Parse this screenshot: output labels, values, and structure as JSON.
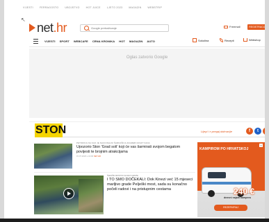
{
  "topbar": [
    "Vijesti",
    "Ferragosto",
    "Ubojstvo",
    "Hot Juice",
    "Ljeto 2023",
    "Magazin",
    "Webstrip"
  ],
  "logo": {
    "mark": "▶",
    "prefix": "net",
    "suffix": ".hr"
  },
  "search": {
    "placeholder": "Google pretraživanje"
  },
  "header_right": {
    "freemail": "Freemail",
    "register": "REGISTRACIJA"
  },
  "nav": [
    "VIJESTI",
    "SPORT",
    "WEBCAFE",
    "CRNA KRONIKA",
    "HOT",
    "MAGAZIN",
    "AUTO"
  ],
  "nav_right": [
    {
      "label": "Sokolina",
      "icon": "gift-icon"
    },
    {
      "label": "Recepti",
      "icon": "leaf-icon"
    },
    {
      "label": "Webshop",
      "icon": "cart-icon"
    }
  ],
  "ad_label": "Oglas zatvorio Google",
  "section": {
    "name": "STON",
    "tagline": "Lijepi i n pregaj dalmacije"
  },
  "social": [
    {
      "name": "facebook-icon",
      "glyph": "f",
      "color": "#e35a1e"
    },
    {
      "name": "twitter-icon",
      "glyph": "t",
      "color": "#1d60c8"
    },
    {
      "name": "instagram-icon",
      "glyph": "i",
      "color": "#e35a1e"
    }
  ],
  "article1": {
    "kicker": "PETORICA NA KAO JE NACIONALNI ŠARKAŠICA ZAGREB CRAFT FANA",
    "title": "Upozorio Ston 'Grad soli' koji će vas šarmirati svojom begatom povijesti te brojnim atrakcijama",
    "byline_prefix": "15.07.2023 u 13:00",
    "byline_source": "NET.HR"
  },
  "article2": {
    "kicker": "ŠARAŠKI MOSTOVI SLAVE 5 GRUPE",
    "title": "I TO SMO DOČEKALI: Dok Kinezi već 15 mjeseci marljivo grade Pelješki most, sada su konačno počeli radovi i na pristupnim cestama"
  },
  "side_ad": {
    "headline": "Kampirom po Hrvatskoj",
    "price": "240 €",
    "sub": "dnevni najam kampera",
    "cta": "REZERVIRAJ"
  }
}
